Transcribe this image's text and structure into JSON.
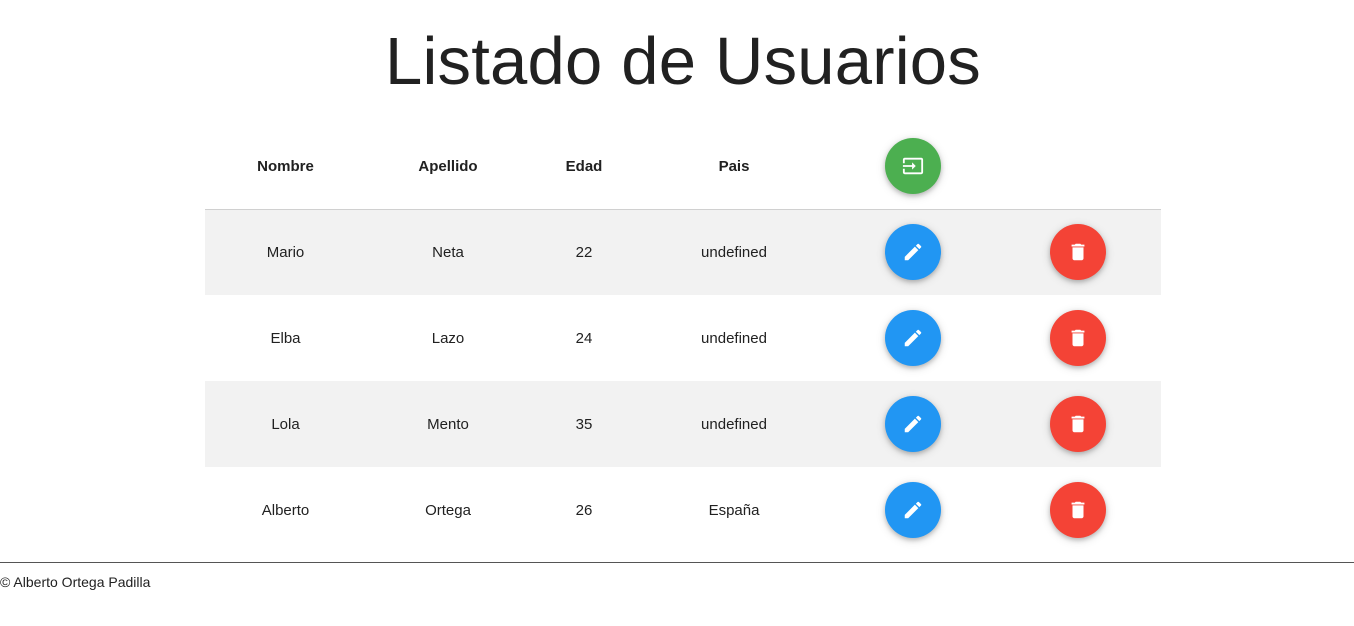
{
  "page": {
    "title": "Listado de Usuarios"
  },
  "table": {
    "headers": {
      "nombre": "Nombre",
      "apellido": "Apellido",
      "edad": "Edad",
      "pais": "Pais"
    },
    "rows": [
      {
        "nombre": "Mario",
        "apellido": "Neta",
        "edad": "22",
        "pais": "undefined"
      },
      {
        "nombre": "Elba",
        "apellido": "Lazo",
        "edad": "24",
        "pais": "undefined"
      },
      {
        "nombre": "Lola",
        "apellido": "Mento",
        "edad": "35",
        "pais": "undefined"
      },
      {
        "nombre": "Alberto",
        "apellido": "Ortega",
        "edad": "26",
        "pais": "España"
      }
    ]
  },
  "icons": {
    "add_user": "login-icon",
    "edit": "pencil-icon",
    "delete": "trash-icon"
  },
  "colors": {
    "add_button": "#4caf50",
    "edit_button": "#2196f3",
    "delete_button": "#f44336",
    "striped_row": "#f2f2f2"
  },
  "footer": {
    "text": "© Alberto Ortega Padilla"
  }
}
